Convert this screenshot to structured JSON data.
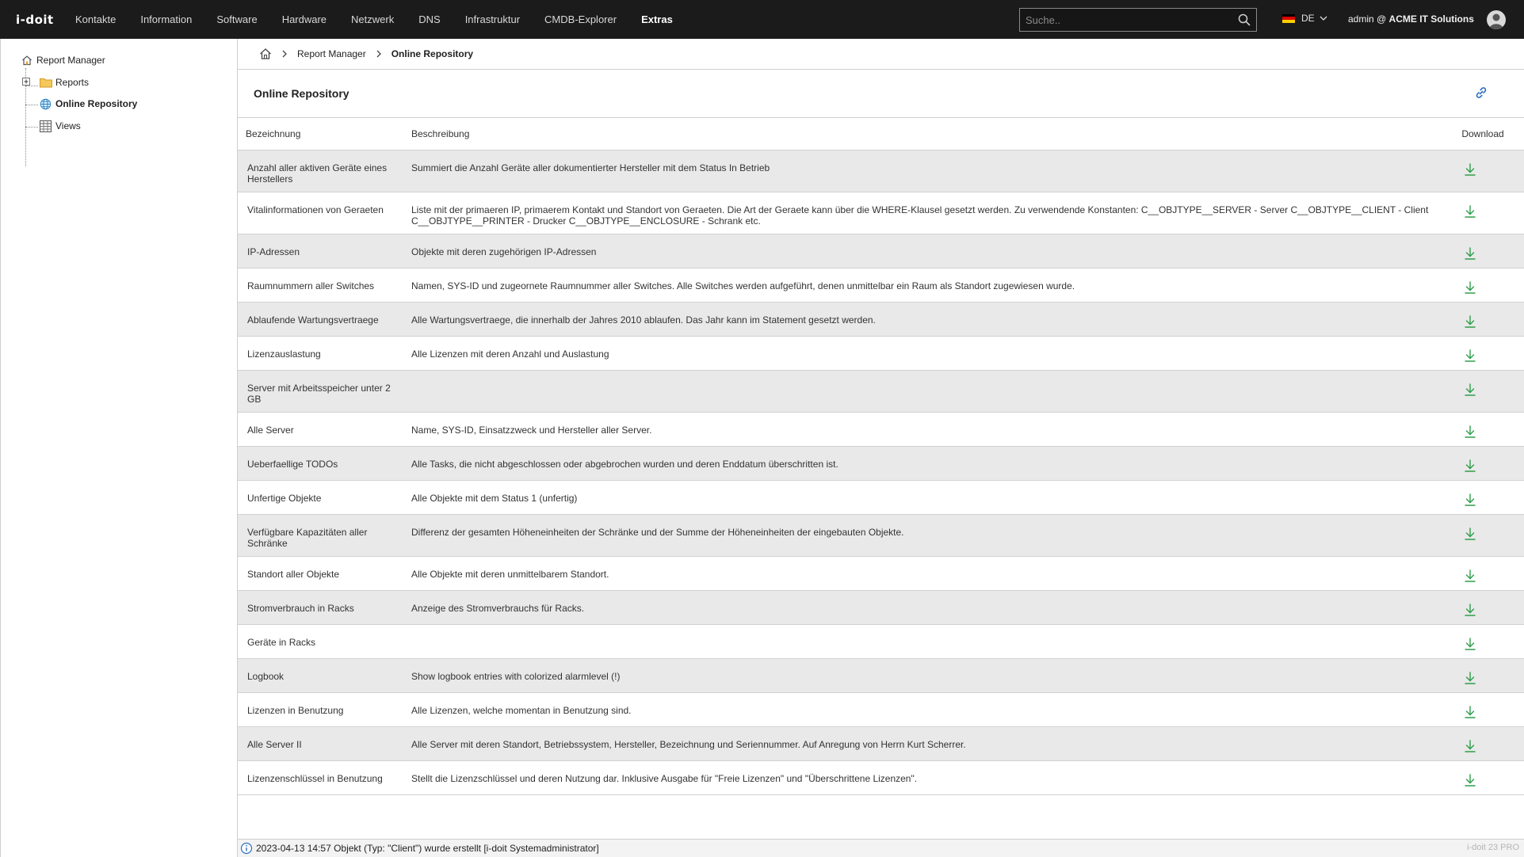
{
  "app": {
    "logo": "i-doit",
    "nav": [
      "Kontakte",
      "Information",
      "Software",
      "Hardware",
      "Netzwerk",
      "DNS",
      "Infrastruktur",
      "CMDB-Explorer",
      "Extras"
    ],
    "active_nav": "Extras",
    "search_placeholder": "Suche..",
    "language": "DE",
    "user_prefix": "admin @",
    "user_org": "ACME IT Solutions"
  },
  "sidebar": {
    "root": "Report Manager",
    "items": [
      {
        "label": "Reports",
        "icon": "folder-icon"
      },
      {
        "label": "Online Repository",
        "icon": "globe-icon",
        "selected": true
      },
      {
        "label": "Views",
        "icon": "table-icon"
      }
    ]
  },
  "breadcrumb": {
    "home": "home-icon",
    "items": [
      "Report Manager",
      "Online Repository"
    ]
  },
  "page": {
    "title": "Online Repository"
  },
  "table": {
    "headers": {
      "name": "Bezeichnung",
      "desc": "Beschreibung",
      "download": "Download"
    },
    "rows": [
      {
        "name": "Anzahl aller aktiven Geräte eines Herstellers",
        "desc": "Summiert die Anzahl Geräte aller dokumentierter Hersteller mit dem Status In Betrieb"
      },
      {
        "name": "Vitalinformationen von Geraeten",
        "desc": "Liste mit der primaeren IP, primaerem Kontakt und Standort von Geraeten. Die Art der Geraete kann über die WHERE-Klausel gesetzt werden. Zu verwendende Konstanten: C__OBJTYPE__SERVER - Server C__OBJTYPE__CLIENT - Client C__OBJTYPE__PRINTER - Drucker C__OBJTYPE__ENCLOSURE - Schrank etc."
      },
      {
        "name": "IP-Adressen",
        "desc": "Objekte mit deren zugehörigen IP-Adressen"
      },
      {
        "name": "Raumnummern aller Switches",
        "desc": "Namen, SYS-ID und zugeornete Raumnummer aller Switches. Alle Switches werden aufgeführt, denen unmittelbar ein Raum als Standort zugewiesen wurde."
      },
      {
        "name": "Ablaufende Wartungsvertraege",
        "desc": "Alle Wartungsvertraege, die innerhalb der Jahres 2010 ablaufen. Das Jahr kann im Statement gesetzt werden."
      },
      {
        "name": "Lizenzauslastung",
        "desc": "Alle Lizenzen mit deren Anzahl und Auslastung"
      },
      {
        "name": "Server mit Arbeitsspeicher unter 2 GB",
        "desc": ""
      },
      {
        "name": "Alle Server",
        "desc": "Name, SYS-ID, Einsatzzweck und Hersteller aller Server."
      },
      {
        "name": "Ueberfaellige TODOs",
        "desc": "Alle Tasks, die nicht abgeschlossen oder abgebrochen wurden und deren Enddatum überschritten ist."
      },
      {
        "name": "Unfertige Objekte",
        "desc": "Alle Objekte mit dem Status 1 (unfertig)"
      },
      {
        "name": "Verfügbare Kapazitäten aller Schränke",
        "desc": "Differenz der gesamten Höheneinheiten der Schränke und der Summe der Höheneinheiten der eingebauten Objekte."
      },
      {
        "name": "Standort aller Objekte",
        "desc": "Alle Objekte mit deren unmittelbarem Standort."
      },
      {
        "name": "Stromverbrauch in Racks",
        "desc": "Anzeige des Stromverbrauchs für Racks."
      },
      {
        "name": "Geräte in Racks",
        "desc": ""
      },
      {
        "name": "Logbook",
        "desc": "Show logbook entries with colorized alarmlevel (!)"
      },
      {
        "name": "Lizenzen in Benutzung",
        "desc": "Alle Lizenzen, welche momentan in Benutzung sind."
      },
      {
        "name": "Alle Server II",
        "desc": "Alle Server mit deren Standort, Betriebssystem, Hersteller, Bezeichnung und Seriennummer. Auf Anregung von Herrn Kurt Scherrer."
      },
      {
        "name": "Lizenzenschlüssel in Benutzung",
        "desc": "Stellt die Lizenzschlüssel und deren Nutzung dar. Inklusive Ausgabe für \"Freie Lizenzen\" und \"Überschrittene Lizenzen\"."
      }
    ]
  },
  "status": {
    "message": "2023-04-13 14:57 Objekt (Typ: \"Client\") wurde erstellt [i-doit Systemadministrator]",
    "version": "i-doit 23 PRO"
  },
  "colors": {
    "topbar": "#1b1b1b",
    "download_green": "#2e9e4a",
    "row_alt": "#e8e9e8"
  }
}
